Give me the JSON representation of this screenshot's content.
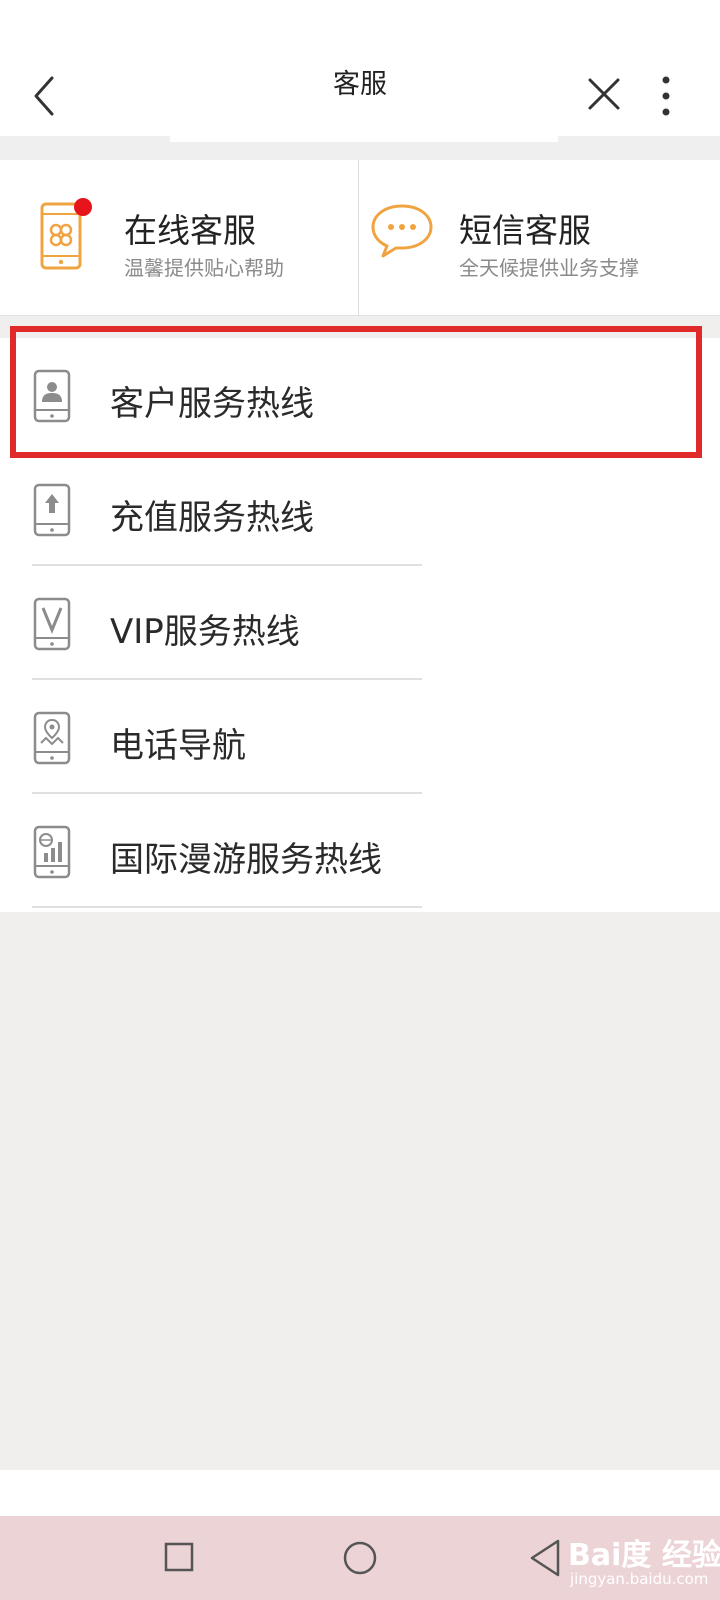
{
  "header": {
    "title": "客服",
    "back_icon": "back-arrow-icon",
    "close_icon": "close-icon",
    "more_icon": "more-vertical-icon"
  },
  "cards": [
    {
      "title": "在线客服",
      "subtitle": "温馨提供贴心帮助",
      "icon": "phone-online-icon",
      "badge_color": "#e8141b"
    },
    {
      "title": "短信客服",
      "subtitle": "全天候提供业务支撑",
      "icon": "chat-bubble-icon"
    }
  ],
  "list": {
    "items": [
      {
        "label": "客户服务热线",
        "icon": "phone-person-icon"
      },
      {
        "label": "充值服务热线",
        "icon": "phone-upload-icon"
      },
      {
        "label": "VIP服务热线",
        "icon": "phone-vip-icon"
      },
      {
        "label": "电话导航",
        "icon": "phone-map-icon"
      },
      {
        "label": "国际漫游服务热线",
        "icon": "phone-globe-icon"
      }
    ]
  },
  "watermark": {
    "main": "Bai度 经验",
    "sub": "jingyan.baidu.com"
  },
  "colors": {
    "accent_orange": "#f0a441",
    "highlight_red": "#e02a2a",
    "icon_gray": "#8c8c8c",
    "navbar_bg": "#ecd3d6"
  }
}
